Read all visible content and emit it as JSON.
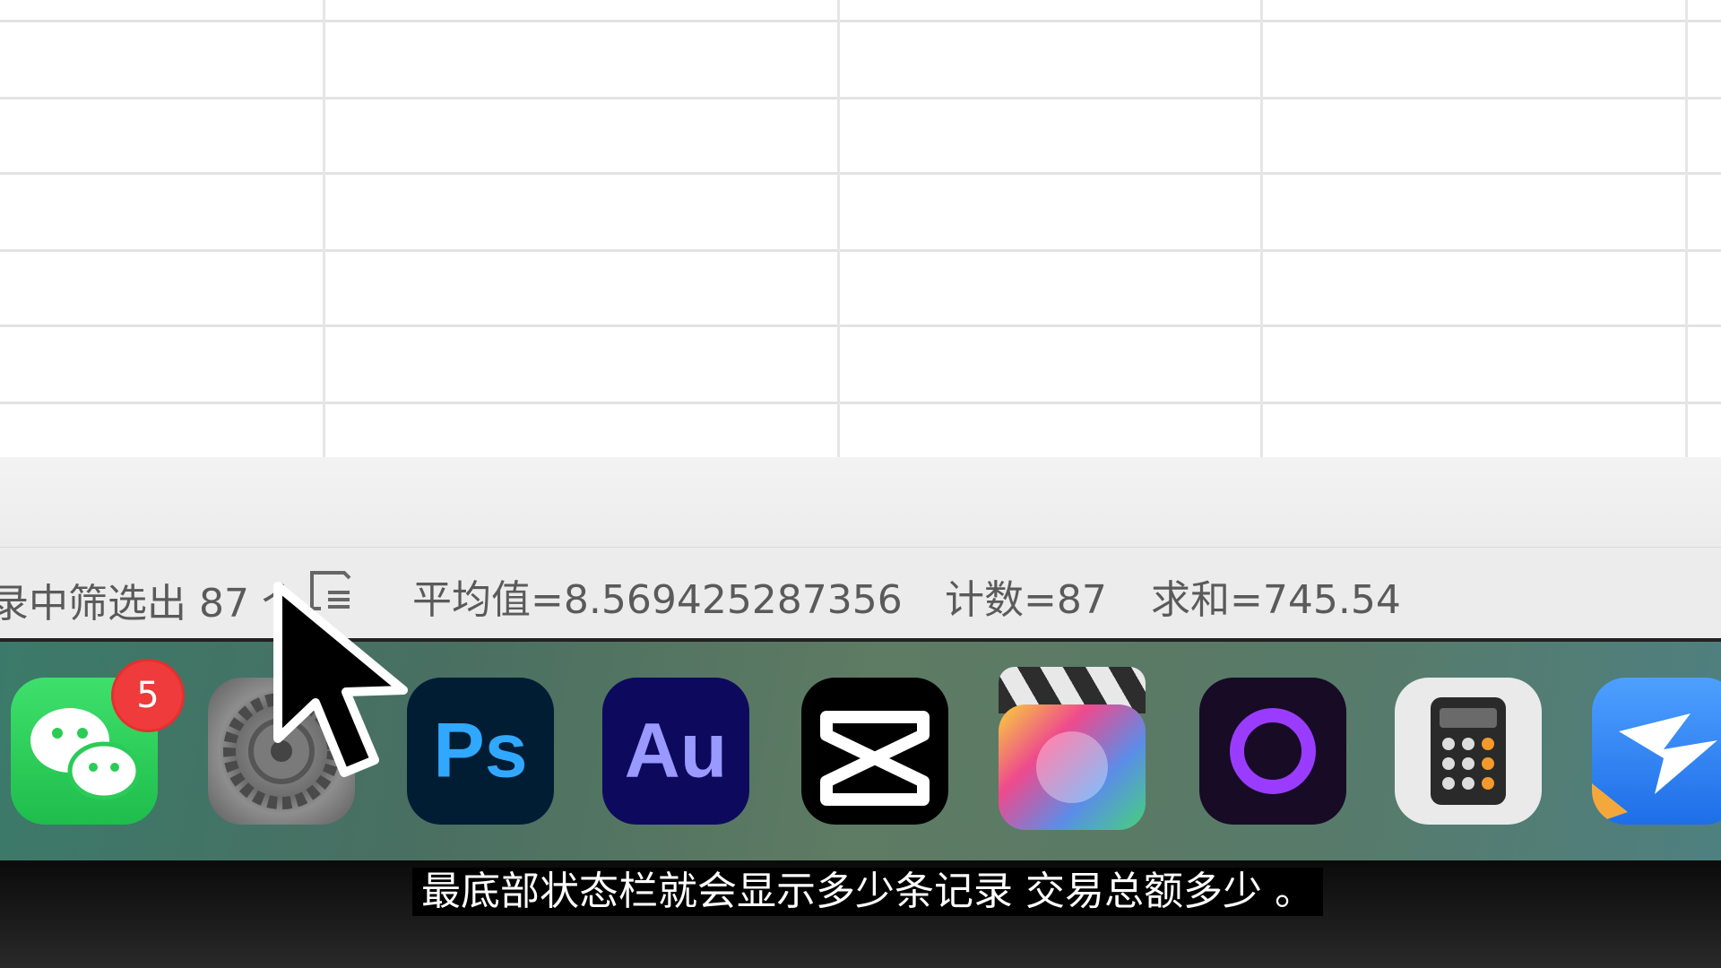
{
  "status_bar": {
    "filter_text": "录中筛选出 87 个",
    "average": "平均值=8.569425287356",
    "count": "计数=87",
    "sum": "求和=745.54"
  },
  "dock": {
    "apps": [
      {
        "name": "WeChat",
        "icon": "wechat-icon",
        "badge": "5"
      },
      {
        "name": "System Preferences",
        "icon": "gear-icon"
      },
      {
        "name": "Photoshop",
        "label": "Ps"
      },
      {
        "name": "Audition",
        "label": "Au"
      },
      {
        "name": "CapCut",
        "icon": "capcut-icon"
      },
      {
        "name": "Final Cut Pro",
        "icon": "clapper-icon"
      },
      {
        "name": "Orb app",
        "icon": "ring-icon"
      },
      {
        "name": "Calculator",
        "icon": "calculator-icon"
      },
      {
        "name": "Download Pro",
        "icon": "bird-icon"
      }
    ]
  },
  "subtitle": "最底部状态栏就会显示多少条记录 交易总额多少 。"
}
